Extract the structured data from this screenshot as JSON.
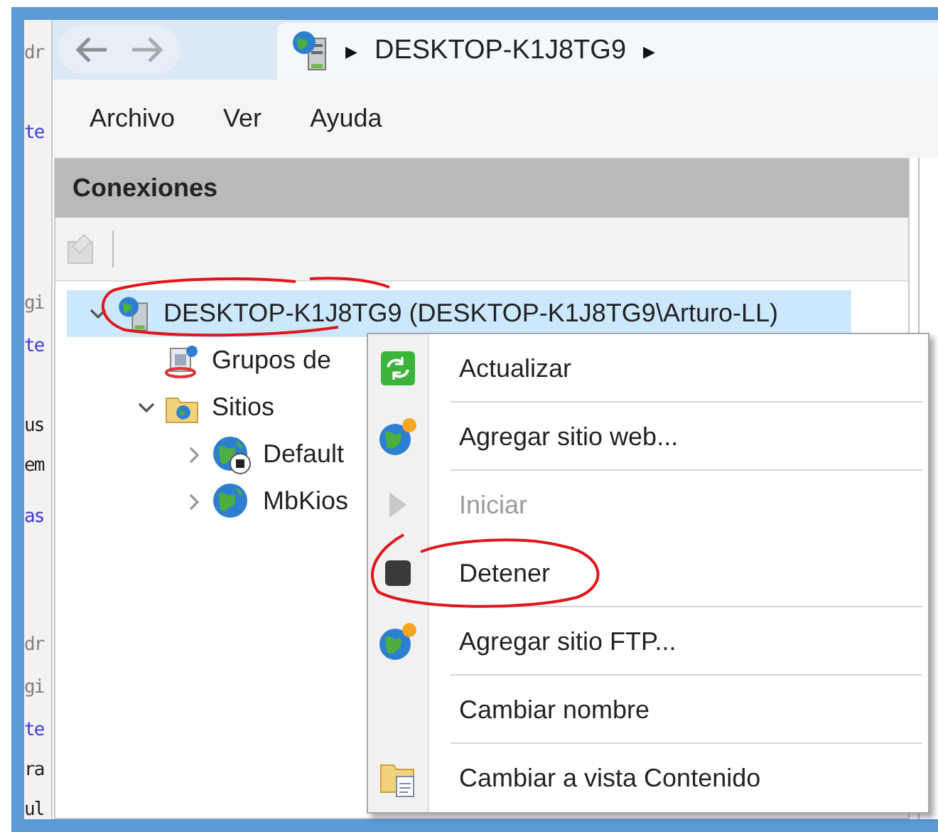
{
  "left_strip": [
    {
      "text": "dr",
      "color": "#808080"
    },
    {
      "text": "te",
      "color": "#3a3ad8"
    },
    {
      "text": "gi",
      "color": "#808080"
    },
    {
      "text": "te",
      "color": "#3a3ad8"
    },
    {
      "text": "us",
      "color": "#202020"
    },
    {
      "text": "em",
      "color": "#202020"
    },
    {
      "text": "as",
      "color": "#3a3ad8"
    },
    {
      "text": "dr",
      "color": "#808080"
    },
    {
      "text": "gi",
      "color": "#808080"
    },
    {
      "text": "te",
      "color": "#3a3ad8"
    },
    {
      "text": "ra",
      "color": "#202020"
    },
    {
      "text": "ul",
      "color": "#202020"
    }
  ],
  "breadcrumb": {
    "separator": "▶",
    "item": "DESKTOP-K1J8TG9",
    "trailing": "▶"
  },
  "menu_bar": [
    "Archivo",
    "Ver",
    "Ayuda"
  ],
  "connections": {
    "title": "Conexiones",
    "tree": [
      {
        "label": "DESKTOP-K1J8TG9 (DESKTOP-K1J8TG9\\Arturo-LL)",
        "kind": "server",
        "expanded": true,
        "selected": true,
        "children": [
          {
            "label": "Grupos de",
            "kind": "pools",
            "selected": false
          },
          {
            "label": "Sitios",
            "kind": "sites",
            "expanded": true,
            "selected": false,
            "children": [
              {
                "label": "Default",
                "kind": "site-stopped",
                "expanded": false,
                "selected": false
              },
              {
                "label": "MbKios",
                "kind": "site",
                "expanded": false,
                "selected": false
              }
            ]
          }
        ]
      }
    ]
  },
  "context_menu": [
    {
      "label": "Actualizar",
      "kind": "refresh",
      "disabled": false,
      "separator_after": true
    },
    {
      "label": "Agregar sitio web...",
      "kind": "add-site",
      "disabled": false,
      "separator_after": true
    },
    {
      "label": "Iniciar",
      "kind": "start",
      "disabled": true,
      "separator_after": false
    },
    {
      "label": "Detener",
      "kind": "stop",
      "disabled": false,
      "separator_after": true
    },
    {
      "label": "Agregar sitio FTP...",
      "kind": "add-site",
      "disabled": false,
      "separator_after": true
    },
    {
      "label": "Cambiar nombre",
      "kind": "none",
      "disabled": false,
      "separator_after": true
    },
    {
      "label": "Cambiar a vista Contenido",
      "kind": "content-view",
      "disabled": false,
      "separator_after": false
    }
  ]
}
